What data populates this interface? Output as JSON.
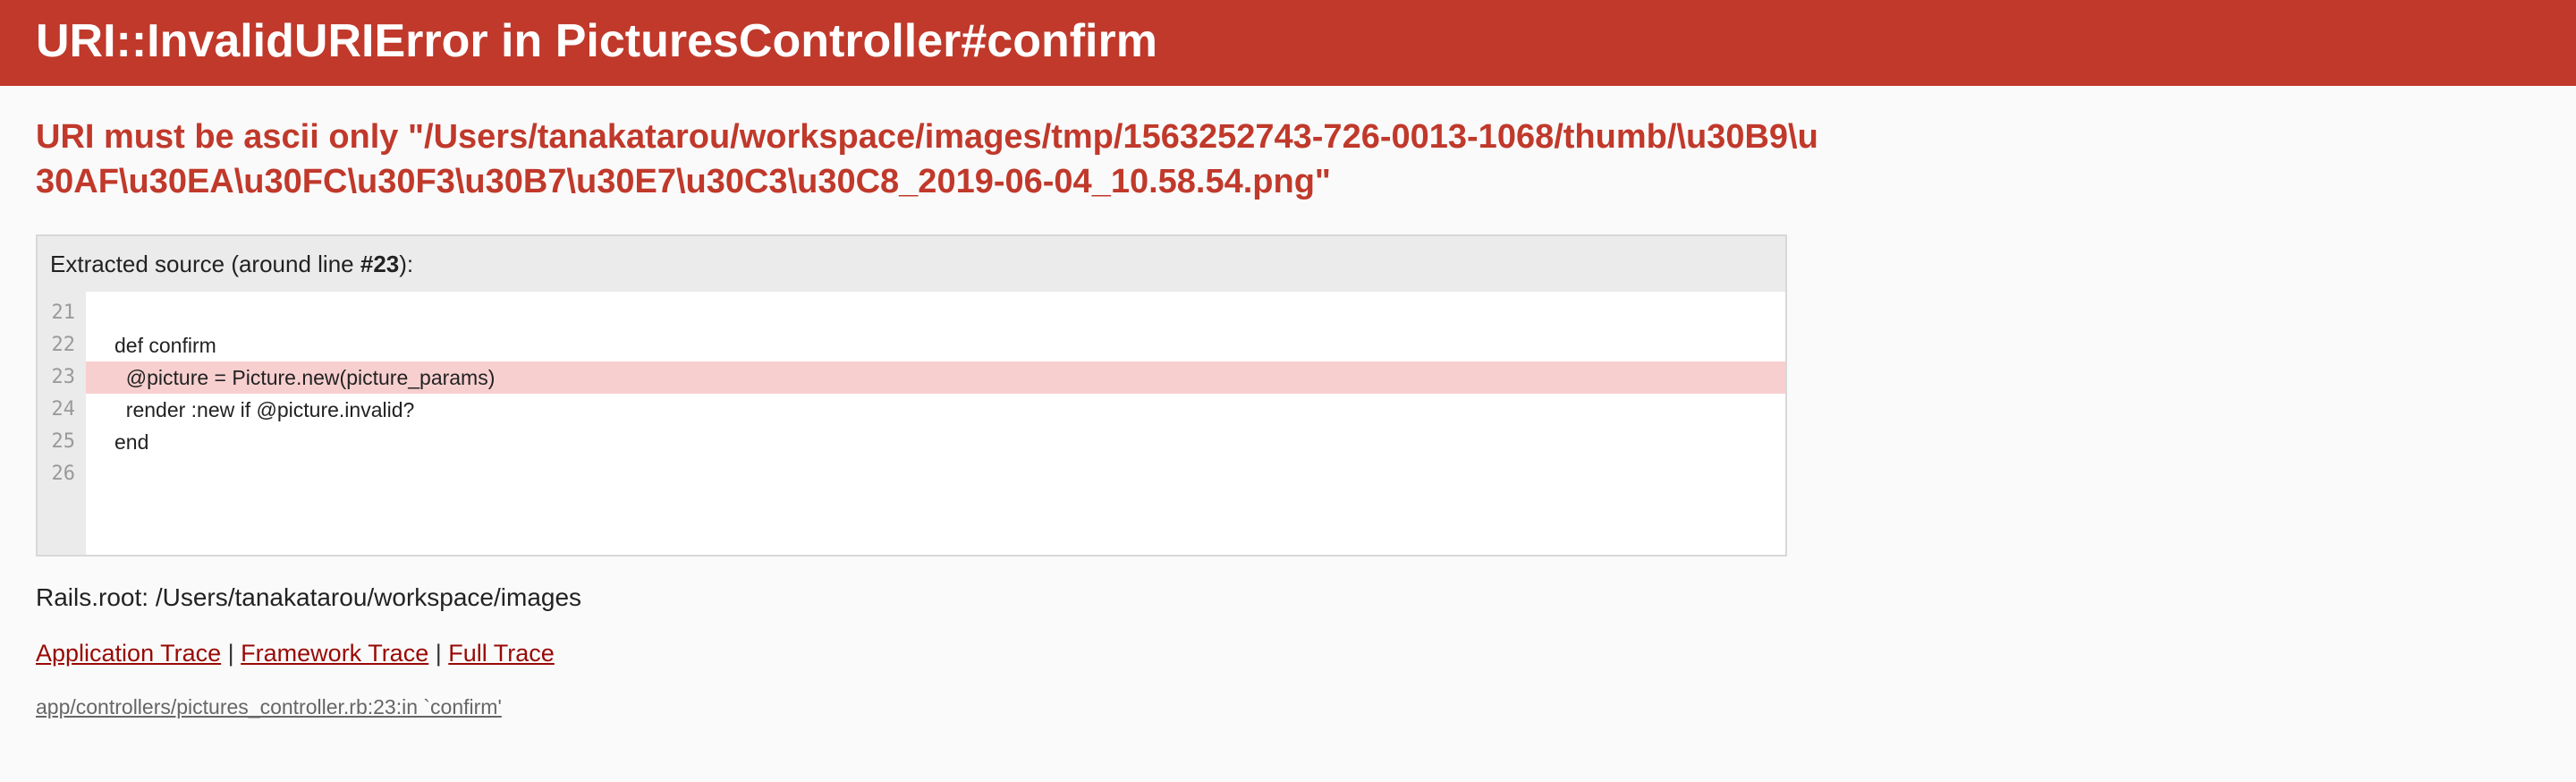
{
  "header": {
    "title": "URI::InvalidURIError in PicturesController#confirm"
  },
  "error_message": "URI must be ascii only \"/Users/tanakatarou/workspace/images/tmp/1563252743-726-0013-1068/thumb/\\u30B9\\u30AF\\u30EA\\u30FC\\u30F3\\u30B7\\u30E7\\u30C3\\u30C8_2019-06-04_10.58.54.png\"",
  "source": {
    "caption_prefix": "Extracted source (around line ",
    "caption_line": "#23",
    "caption_suffix": "):",
    "lines": [
      {
        "no": "21",
        "code": ""
      },
      {
        "no": "22",
        "code": "def confirm"
      },
      {
        "no": "23",
        "code": "  @picture = Picture.new(picture_params)"
      },
      {
        "no": "24",
        "code": "  render :new if @picture.invalid?"
      },
      {
        "no": "25",
        "code": "end"
      },
      {
        "no": "26",
        "code": ""
      }
    ],
    "highlight_line": "23"
  },
  "rails_root": "Rails.root: /Users/tanakatarou/workspace/images",
  "traces": {
    "application": "Application Trace",
    "framework": "Framework Trace",
    "full": "Full Trace",
    "separator": "|"
  },
  "trace_entry": "app/controllers/pictures_controller.rb:23:in `confirm'",
  "colors": {
    "header_bg": "#c0392b",
    "error_text": "#c0392b",
    "highlight_bg": "#f8cfcf",
    "link": "#980905"
  }
}
